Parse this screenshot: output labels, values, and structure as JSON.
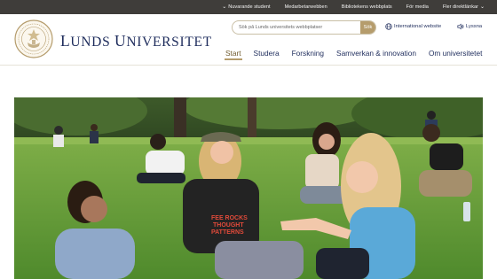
{
  "topbar": {
    "links": [
      {
        "label": "Nuvarande student",
        "dropdown": true
      },
      {
        "label": "Medarbetarwebben",
        "dropdown": false
      },
      {
        "label": "Bibliotekens webbplats",
        "dropdown": false
      },
      {
        "label": "För media",
        "dropdown": false
      },
      {
        "label": "Fler direktlänkar",
        "dropdown": true
      }
    ]
  },
  "brand": {
    "first_initial": "L",
    "first_rest": "UNDS",
    "second_initial": "U",
    "second_rest": "NIVERSITET"
  },
  "search": {
    "placeholder": "Sök på Lunds universitets webbplatser",
    "button_label": "Sök"
  },
  "utility": {
    "international": "International website",
    "listen": "Lyssna"
  },
  "nav": {
    "items": [
      {
        "label": "Start",
        "active": true
      },
      {
        "label": "Studera",
        "active": false
      },
      {
        "label": "Forskning",
        "active": false
      },
      {
        "label": "Samverkan & innovation",
        "active": false
      },
      {
        "label": "Om universitetet",
        "active": false
      }
    ]
  },
  "hero": {
    "shirt_text": [
      "FEE ROCKS",
      "THOUGHT",
      "PATTERNS"
    ]
  },
  "colors": {
    "topbar_bg": "#3f3d3a",
    "brand_navy": "#1e2c5c",
    "accent_gold": "#b59c6c"
  },
  "icons": {
    "chevron": "chevron-down-icon",
    "globe": "globe-icon",
    "listen": "speaker-icon",
    "seal": "university-seal-logo"
  }
}
